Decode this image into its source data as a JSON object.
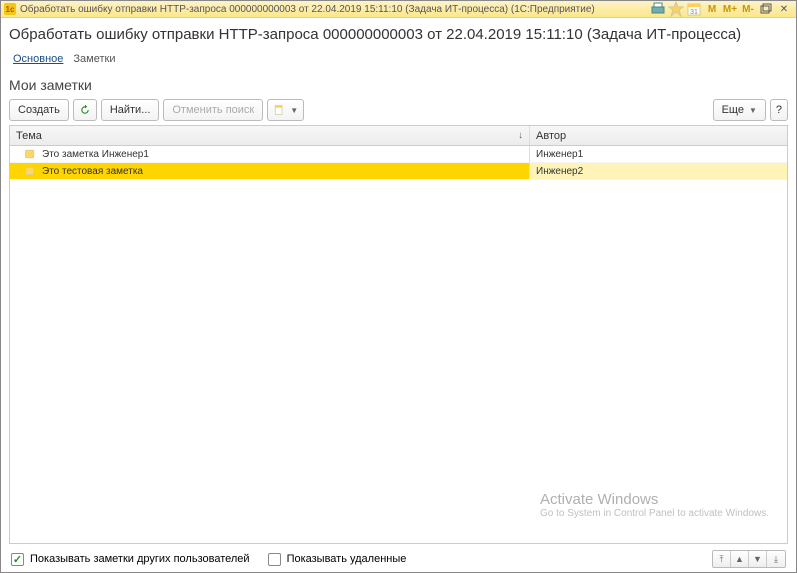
{
  "titlebar": {
    "text": "Обработать ошибку отправки HTTP-запроса 000000000003 от 22.04.2019 15:11:10 (Задача ИТ-процесса)  (1С:Предприятие)"
  },
  "page_title": "Обработать ошибку отправки HTTP-запроса 000000000003 от 22.04.2019 15:11:10 (Задача ИТ-процесса)",
  "tabs": {
    "main": "Основное",
    "notes": "Заметки"
  },
  "section_title": "Мои заметки",
  "toolbar": {
    "create": "Создать",
    "find": "Найти...",
    "cancel_search": "Отменить поиск",
    "more": "Еще"
  },
  "table": {
    "header_theme": "Тема",
    "header_author": "Автор",
    "rows": [
      {
        "theme": "Это заметка Инженер1",
        "author": "Инженер1"
      },
      {
        "theme": "Это тестовая заметка",
        "author": "Инженер2"
      }
    ]
  },
  "footer": {
    "show_other_users": "Показывать заметки других пользователей",
    "show_deleted": "Показывать удаленные"
  },
  "watermark": {
    "line1": "Activate Windows",
    "line2": "Go to System in Control Panel to activate Windows."
  }
}
